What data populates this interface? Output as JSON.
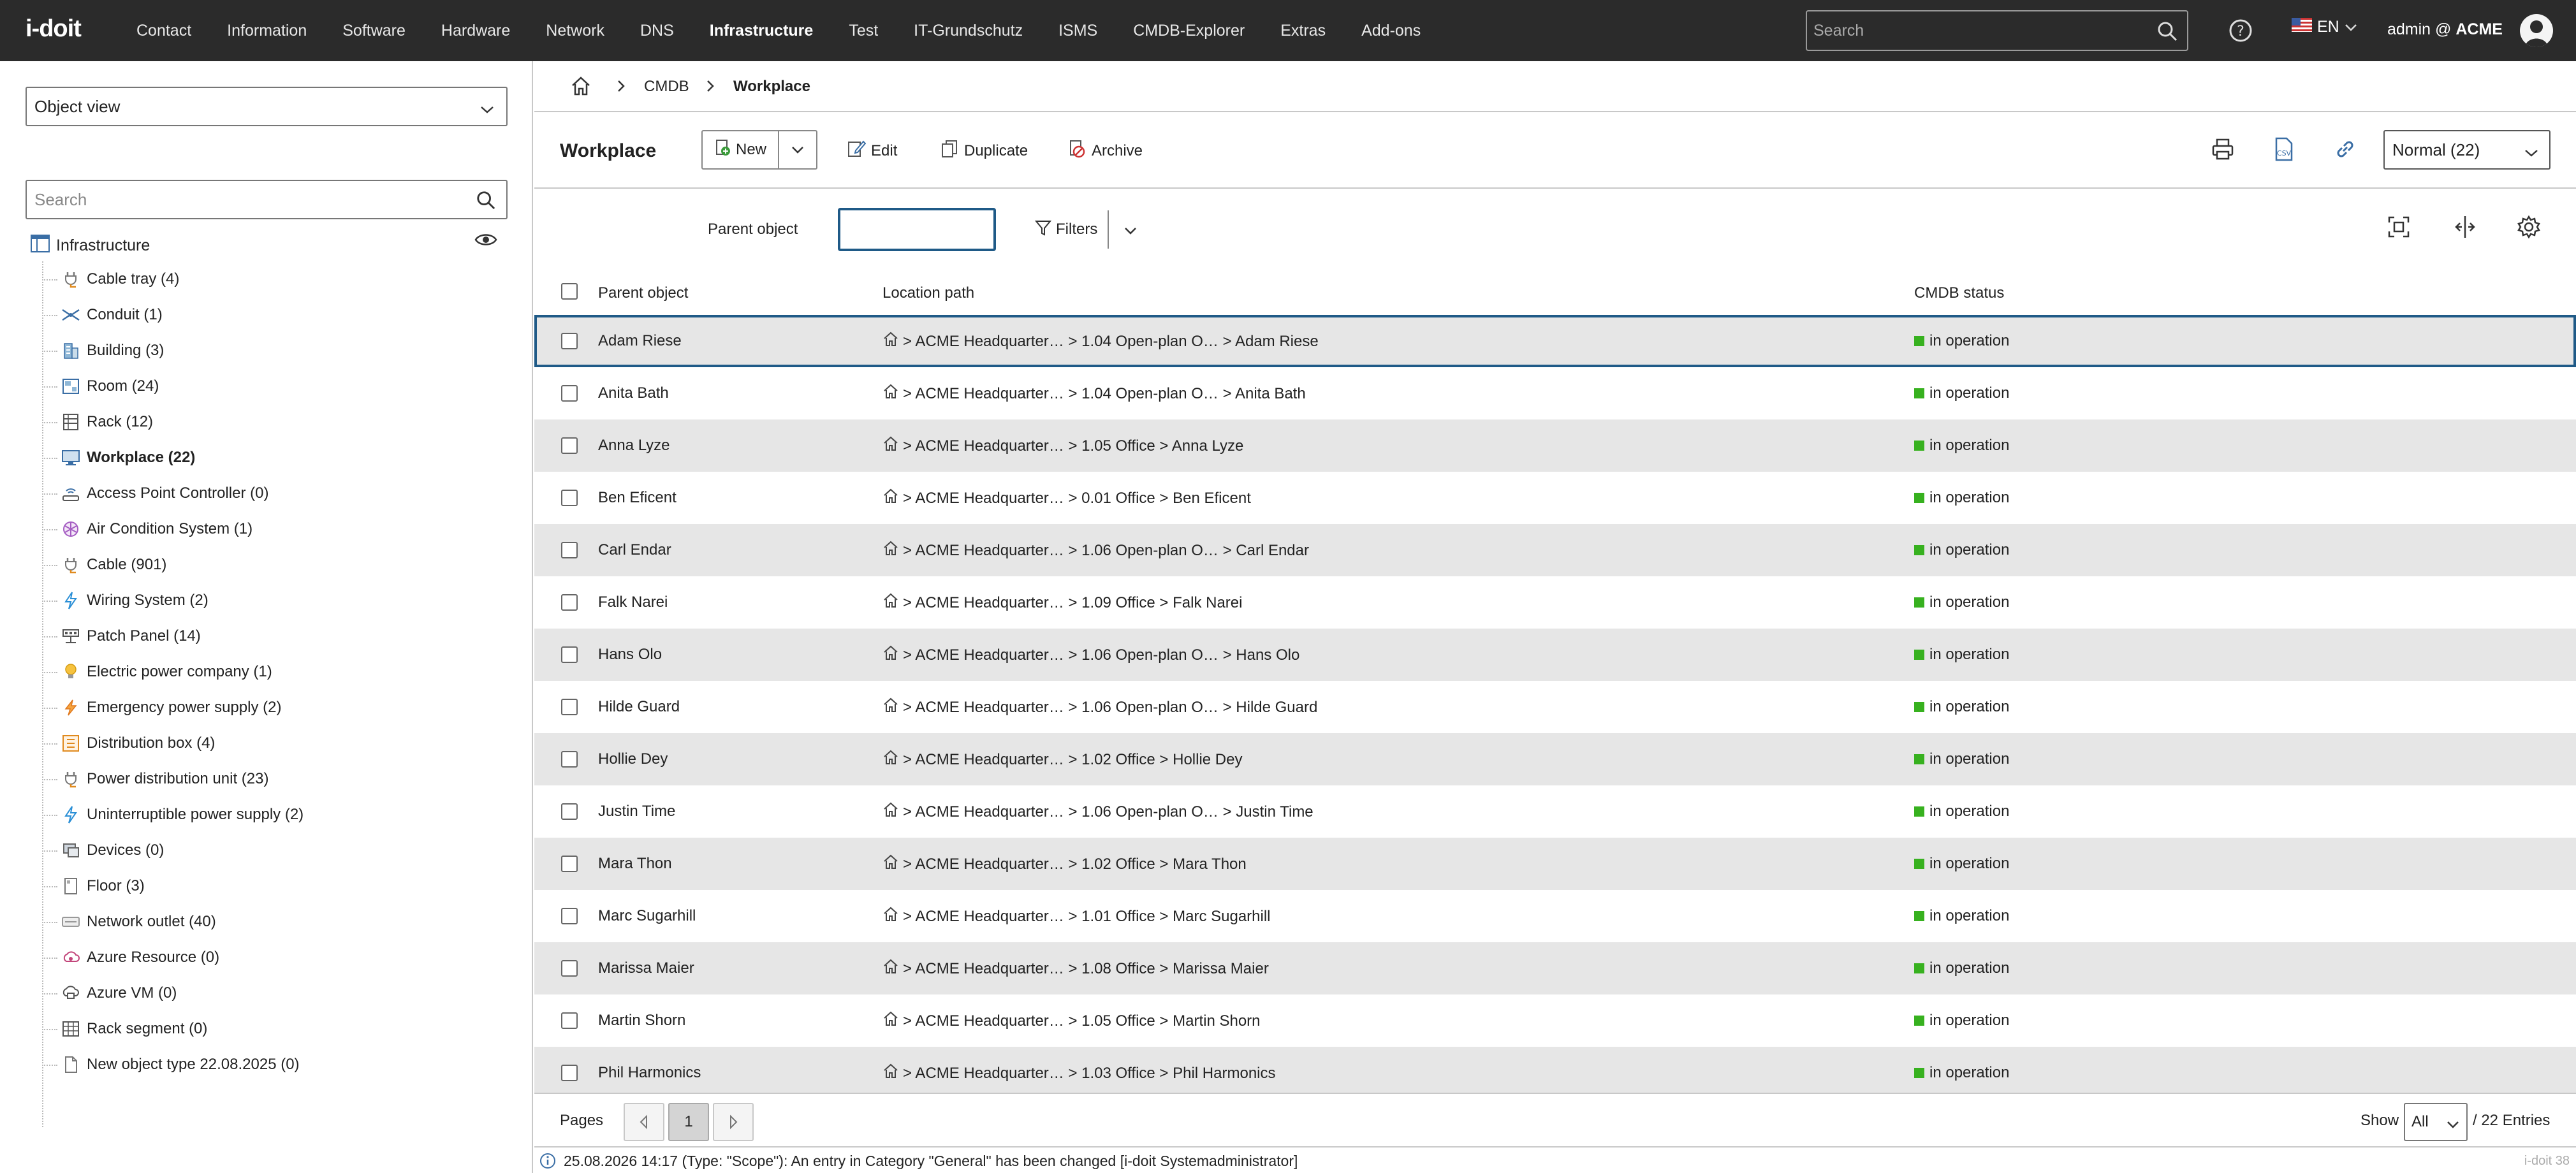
{
  "app": {
    "logo": "i-doit"
  },
  "topnav": {
    "items": [
      "Contact",
      "Information",
      "Software",
      "Hardware",
      "Network",
      "DNS",
      "Infrastructure",
      "Test",
      "IT-Grundschutz",
      "ISMS",
      "CMDB-Explorer",
      "Extras",
      "Add-ons"
    ],
    "active": "Infrastructure",
    "search_placeholder": "Search",
    "language": "EN",
    "user_prefix": "admin @",
    "tenant": "ACME"
  },
  "sidebar": {
    "view_select": "Object view",
    "search_placeholder": "Search",
    "root": "Infrastructure",
    "items": [
      {
        "label": "Cable tray (4)",
        "icon": "plug-icon"
      },
      {
        "label": "Conduit (1)",
        "icon": "conduit-icon"
      },
      {
        "label": "Building (3)",
        "icon": "building-icon"
      },
      {
        "label": "Room (24)",
        "icon": "room-icon"
      },
      {
        "label": "Rack (12)",
        "icon": "rack-icon"
      },
      {
        "label": "Workplace (22)",
        "icon": "monitor-icon"
      },
      {
        "label": "Access Point Controller (0)",
        "icon": "access-point-icon"
      },
      {
        "label": "Air Condition System (1)",
        "icon": "snowflake-icon"
      },
      {
        "label": "Cable (901)",
        "icon": "plug-icon"
      },
      {
        "label": "Wiring System (2)",
        "icon": "lightning-icon"
      },
      {
        "label": "Patch Panel (14)",
        "icon": "patch-panel-icon"
      },
      {
        "label": "Electric power company (1)",
        "icon": "bulb-icon"
      },
      {
        "label": "Emergency power supply (2)",
        "icon": "power-icon"
      },
      {
        "label": "Distribution box (4)",
        "icon": "distribution-box-icon"
      },
      {
        "label": "Power distribution unit (23)",
        "icon": "plug-icon"
      },
      {
        "label": "Uninterruptible power supply (2)",
        "icon": "lightning-icon"
      },
      {
        "label": "Devices (0)",
        "icon": "devices-icon"
      },
      {
        "label": "Floor (3)",
        "icon": "floor-icon"
      },
      {
        "label": "Network outlet (40)",
        "icon": "network-outlet-icon"
      },
      {
        "label": "Azure Resource (0)",
        "icon": "azure-resource-icon"
      },
      {
        "label": "Azure VM (0)",
        "icon": "azure-vm-icon"
      },
      {
        "label": "Rack segment (0)",
        "icon": "rack-segment-icon"
      },
      {
        "label": "New object type 22.08.2025 (0)",
        "icon": "document-icon"
      }
    ],
    "active_index": 5
  },
  "breadcrumb": {
    "items": [
      "CMDB",
      "Workplace"
    ]
  },
  "toolbar": {
    "title": "Workplace",
    "new_label": "New",
    "edit_label": "Edit",
    "duplicate_label": "Duplicate",
    "archive_label": "Archive",
    "mode": "Normal (22)"
  },
  "filter": {
    "parent_label": "Parent object",
    "parent_value": "",
    "filters_label": "Filters"
  },
  "table": {
    "columns": [
      "Parent object",
      "Location path",
      "CMDB status"
    ],
    "rows": [
      {
        "name": "Adam Riese",
        "path": "> ACME Headquarter… > 1.04 Open-plan O… > Adam Riese",
        "status": "in operation"
      },
      {
        "name": "Anita Bath",
        "path": "> ACME Headquarter… > 1.04 Open-plan O… > Anita Bath",
        "status": "in operation"
      },
      {
        "name": "Anna Lyze",
        "path": "> ACME Headquarter… > 1.05 Office > Anna Lyze",
        "status": "in operation"
      },
      {
        "name": "Ben Eficent",
        "path": "> ACME Headquarter… > 0.01 Office > Ben Eficent",
        "status": "in operation"
      },
      {
        "name": "Carl Endar",
        "path": "> ACME Headquarter… > 1.06 Open-plan O… > Carl Endar",
        "status": "in operation"
      },
      {
        "name": "Falk Narei",
        "path": "> ACME Headquarter… > 1.09 Office > Falk Narei",
        "status": "in operation"
      },
      {
        "name": "Hans Olo",
        "path": "> ACME Headquarter… > 1.06 Open-plan O… > Hans Olo",
        "status": "in operation"
      },
      {
        "name": "Hilde Guard",
        "path": "> ACME Headquarter… > 1.06 Open-plan O… > Hilde Guard",
        "status": "in operation"
      },
      {
        "name": "Hollie Dey",
        "path": "> ACME Headquarter… > 1.02 Office > Hollie Dey",
        "status": "in operation"
      },
      {
        "name": "Justin Time",
        "path": "> ACME Headquarter… > 1.06 Open-plan O… > Justin Time",
        "status": "in operation"
      },
      {
        "name": "Mara Thon",
        "path": "> ACME Headquarter… > 1.02 Office > Mara Thon",
        "status": "in operation"
      },
      {
        "name": "Marc Sugarhill",
        "path": "> ACME Headquarter… > 1.01 Office > Marc Sugarhill",
        "status": "in operation"
      },
      {
        "name": "Marissa Maier",
        "path": "> ACME Headquarter… > 1.08 Office > Marissa Maier",
        "status": "in operation"
      },
      {
        "name": "Martin Shorn",
        "path": "> ACME Headquarter… > 1.05 Office > Martin Shorn",
        "status": "in operation"
      },
      {
        "name": "Phil Harmonics",
        "path": "> ACME Headquarter… > 1.03 Office > Phil Harmonics",
        "status": "in operation"
      }
    ],
    "selected_index": 0,
    "status_color": "#37b11f"
  },
  "pager": {
    "pages_label": "Pages",
    "current": "1",
    "show_label": "Show",
    "show_value": "All",
    "entries": "/ 22 Entries"
  },
  "statusbar": {
    "message": "25.08.2026 14:17 (Type: \"Scope\"): An entry in Category \"General\" has been changed [i-doit Systemadministrator]",
    "version": "i-doit 38"
  },
  "colors": {
    "topbar": "#2b2b2b",
    "accent": "#1f5a87",
    "row_alt": "#e6e6e6"
  }
}
